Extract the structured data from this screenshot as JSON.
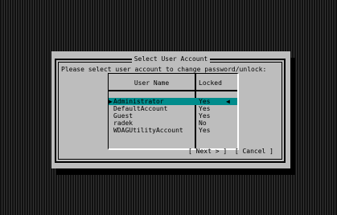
{
  "dialog": {
    "title": "Select User Account",
    "prompt": "Please select user account to change password/unlock:",
    "columns": {
      "user": "User Name",
      "locked": "Locked"
    },
    "rows": [
      {
        "name": "Administrator",
        "locked": "Yes",
        "selected": true
      },
      {
        "name": "DefaultAccount",
        "locked": "Yes",
        "selected": false
      },
      {
        "name": "Guest",
        "locked": "Yes",
        "selected": false
      },
      {
        "name": "radek",
        "locked": "No",
        "selected": false
      },
      {
        "name": "WDAGUtilityAccount",
        "locked": "Yes",
        "selected": false
      }
    ],
    "selection_marker_left": "▶",
    "selection_marker_right": "◀",
    "next_button": "[ Next > ]",
    "cancel_button": "[ Cancel ]"
  },
  "colors": {
    "dialog_bg": "#bdbdbd",
    "selection": "#008c8c",
    "screen_bg": "#101010"
  }
}
